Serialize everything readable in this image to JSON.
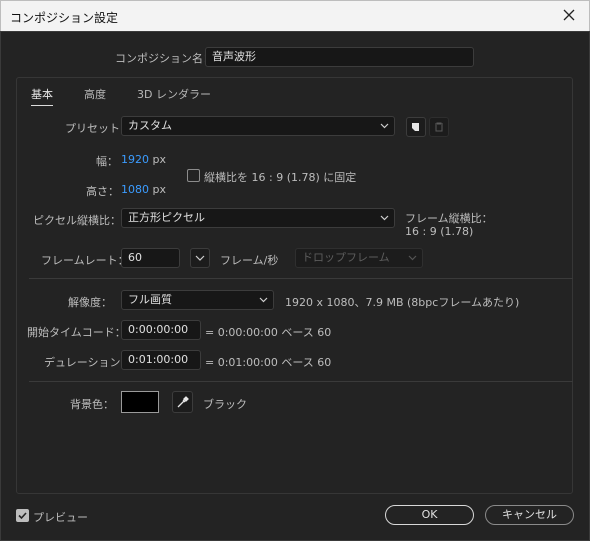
{
  "window": {
    "title": "コンポジション設定",
    "close_label": "close"
  },
  "comp_name": {
    "label": "コンポジション名：",
    "value": "音声波形"
  },
  "tabs": [
    {
      "label": "基本",
      "active": true
    },
    {
      "label": "高度",
      "active": false
    },
    {
      "label": "3D レンダラー",
      "active": false
    }
  ],
  "preset": {
    "label": "プリセット：",
    "value": "カスタム"
  },
  "width": {
    "label": "幅：",
    "value": "1920",
    "unit": "px"
  },
  "height": {
    "label": "高さ：",
    "value": "1080",
    "unit": "px"
  },
  "lock_aspect": {
    "label": "縦横比を 16 : 9 (1.78) に固定",
    "checked": false
  },
  "pixel_aspect": {
    "label": "ピクセル縦横比：",
    "value": "正方形ピクセル",
    "frame_aspect_label": "フレーム縦横比：",
    "frame_aspect_value": "16 : 9 (1.78)"
  },
  "frame_rate": {
    "label": "フレームレート：",
    "value": "60",
    "unit": "フレーム/秒",
    "drop_frame": "ドロップフレーム"
  },
  "resolution": {
    "label": "解像度：",
    "value": "フル画質",
    "info": "1920 x 1080、7.9 MB (8bpcフレームあたり)"
  },
  "start_timecode": {
    "label": "開始タイムコード：",
    "value": "0:00:00:00",
    "info": "= 0:00:00:00  ベース 60"
  },
  "duration": {
    "label": "デュレーション：",
    "value": "0:01:00:00",
    "info": "= 0:01:00:00  ベース 60"
  },
  "background": {
    "label": "背景色：",
    "color": "#000000",
    "name": "ブラック"
  },
  "preview": {
    "label": "プレビュー",
    "checked": true
  },
  "buttons": {
    "ok": "OK",
    "cancel": "キャンセル"
  },
  "colors": {
    "accent_blue": "#3b9cff",
    "dialog_bg": "#232323",
    "titlebar_bg": "#f3f3f3"
  }
}
